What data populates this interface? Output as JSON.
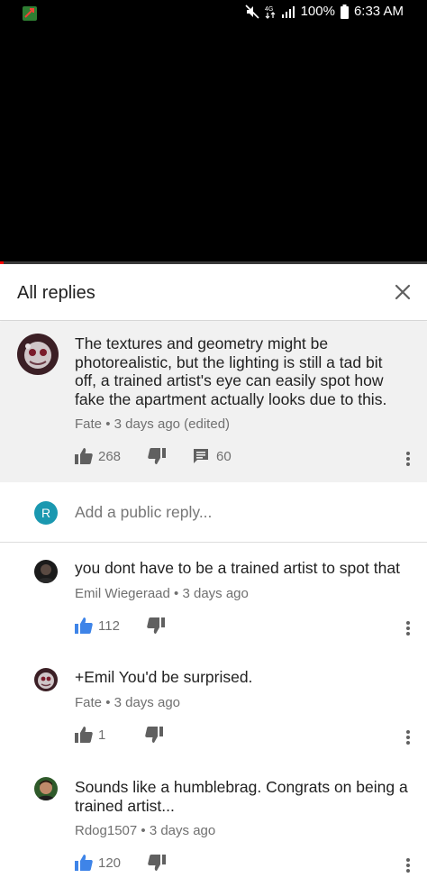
{
  "status_bar": {
    "battery": "100%",
    "time": "6:33 AM"
  },
  "header": {
    "title": "All replies"
  },
  "parent_comment": {
    "text": "The textures and geometry might be photorealistic, but the lighting is still a tad bit off, a trained artist's eye can easily spot how fake the apartment actually looks due to this.",
    "author": "Fate",
    "time": "3 days ago (edited)",
    "likes": "268",
    "replies": "60"
  },
  "reply_input": {
    "avatar_letter": "R",
    "placeholder": "Add a public reply..."
  },
  "replies": [
    {
      "text": "you dont have to be a trained artist to spot that",
      "author": "Emil Wiegeraad",
      "time": "3 days ago",
      "likes": "112",
      "liked": true
    },
    {
      "text": "+Emil You'd be surprised.",
      "author": "Fate",
      "time": "3 days ago",
      "likes": "1",
      "liked": false
    },
    {
      "text": "Sounds like a humblebrag. Congrats on being a trained artist...",
      "author": "Rdog1507",
      "time": "3 days ago",
      "likes": "120",
      "liked": true
    }
  ],
  "colors": {
    "accent_blue": "#3e84e8",
    "icon_grey": "#606060",
    "reply_avatar": "#1a98b0",
    "progress_red": "#ff0000"
  }
}
